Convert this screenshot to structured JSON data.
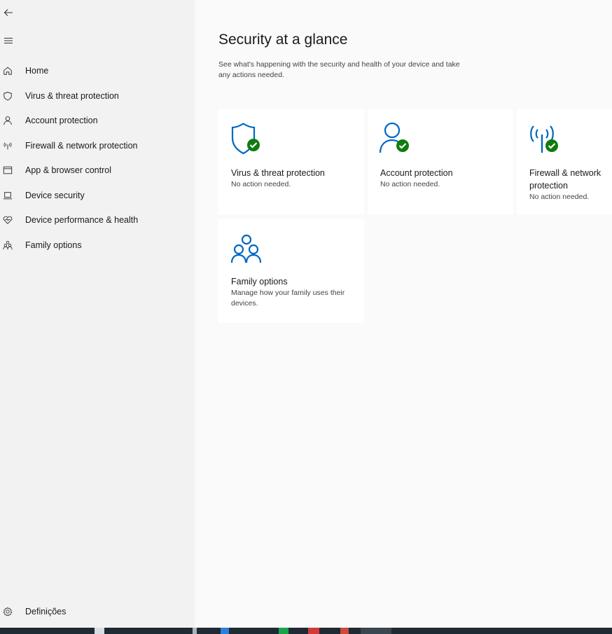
{
  "sidebar": {
    "back_icon": "back-arrow-icon",
    "menu_icon": "hamburger-menu-icon",
    "items": [
      {
        "label": "Home",
        "icon": "home-icon"
      },
      {
        "label": "Virus & threat protection",
        "icon": "shield-icon"
      },
      {
        "label": "Account protection",
        "icon": "person-icon"
      },
      {
        "label": "Firewall & network protection",
        "icon": "antenna-icon"
      },
      {
        "label": "App & browser control",
        "icon": "browser-window-icon"
      },
      {
        "label": "Device security",
        "icon": "laptop-icon"
      },
      {
        "label": "Device performance & health",
        "icon": "heart-icon"
      },
      {
        "label": "Family options",
        "icon": "family-icon"
      }
    ],
    "settings_label": "Definições",
    "settings_icon": "gear-icon"
  },
  "main": {
    "title": "Security at a glance",
    "subtitle": "See what's happening with the security and health of your device and take any actions needed.",
    "cards": [
      {
        "title": "Virus & threat protection",
        "status": "No action needed.",
        "icon": "shield-check-icon"
      },
      {
        "title": "Account protection",
        "status": "No action needed.",
        "icon": "person-check-icon"
      },
      {
        "title": "Firewall & network protection",
        "status": "No action needed.",
        "icon": "antenna-check-icon"
      },
      {
        "title": "Family options",
        "status": "Manage how your family uses their devices.",
        "icon": "family-icon"
      }
    ]
  },
  "colors": {
    "accent": "#0067c0",
    "ok_green": "#107c10",
    "sidebar_bg": "#f2f2f2",
    "main_bg": "#fafafa",
    "taskbar_bg": "#1f2a33"
  }
}
